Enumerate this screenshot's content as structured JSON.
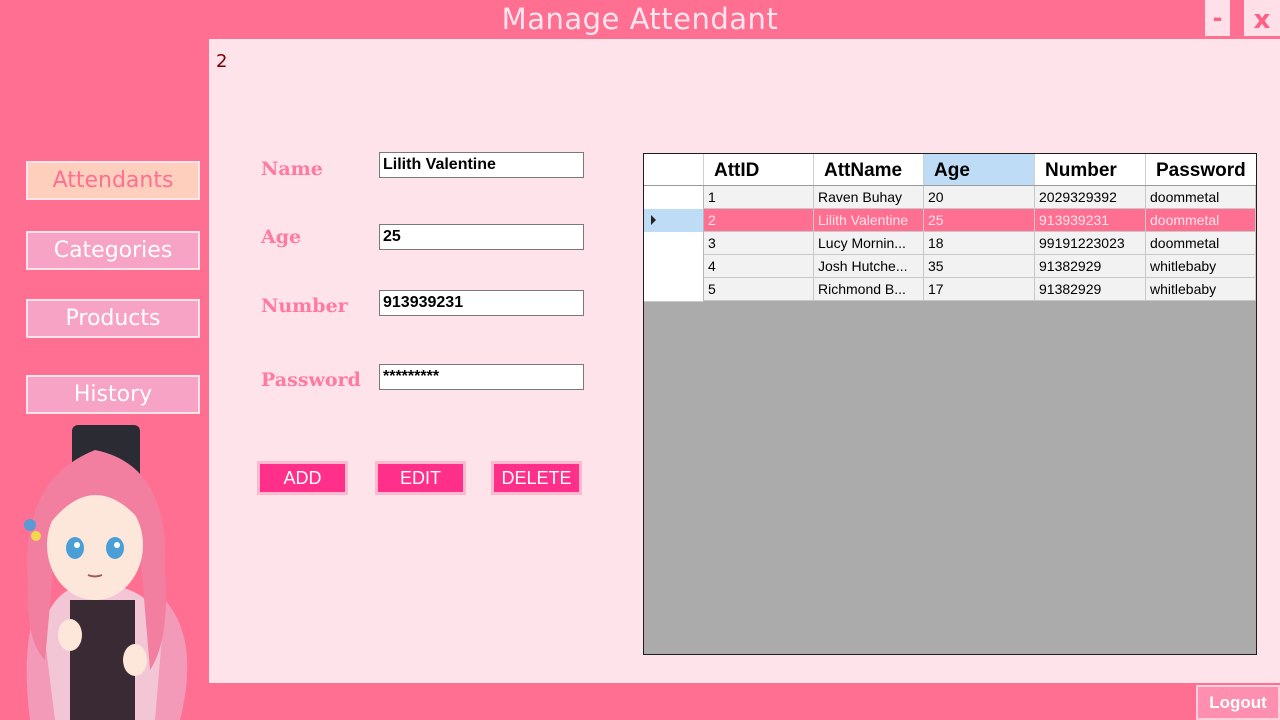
{
  "window": {
    "title": "Manage Attendant",
    "minimize_label": "-",
    "close_label": "x"
  },
  "selected_id": "2",
  "sidebar": {
    "items": [
      {
        "label": "Attendants",
        "active": true
      },
      {
        "label": "Categories",
        "active": false
      },
      {
        "label": "Products",
        "active": false
      },
      {
        "label": "History",
        "active": false
      }
    ]
  },
  "form": {
    "name_label": "Name",
    "name_value": "Lilith Valentine",
    "age_label": "Age",
    "age_value": "25",
    "number_label": "Number",
    "number_value": "913939231",
    "password_label": "Password",
    "password_value": "*********"
  },
  "actions": {
    "add": "ADD",
    "edit": "EDIT",
    "delete": "DELETE"
  },
  "table": {
    "columns": [
      "AttID",
      "AttName",
      "Age",
      "Number",
      "Password"
    ],
    "sorted_column": "Age",
    "selected_row": 1,
    "rows": [
      [
        "1",
        "Raven Buhay",
        "20",
        "2029329392",
        "doommetal"
      ],
      [
        "2",
        "Lilith Valentine",
        "25",
        "913939231",
        "doommetal"
      ],
      [
        "3",
        "Lucy Mornin...",
        "18",
        "99191223023",
        "doommetal"
      ],
      [
        "4",
        "Josh Hutche...",
        "35",
        "91382929",
        "whitlebaby"
      ],
      [
        "5",
        "Richmond B...",
        "17",
        "91382929",
        "whitlebaby"
      ]
    ]
  },
  "logout_label": "Logout",
  "colors": {
    "accent": "#ff6f92",
    "panel": "#ffe3ea",
    "button": "#ff2f8a",
    "grid_background": "#ababab"
  }
}
